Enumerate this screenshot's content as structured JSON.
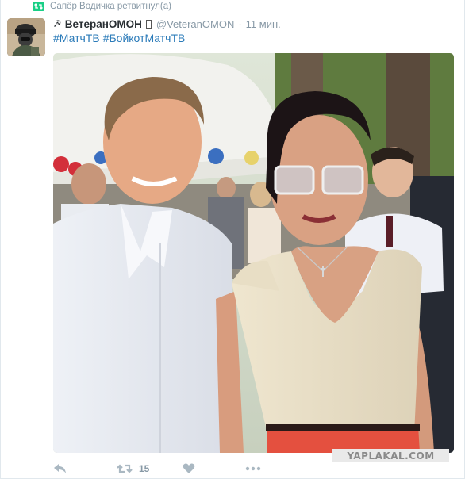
{
  "retweet_context": {
    "text": "Сапёр Водичка ретвитнул(а)",
    "icon": "retweet-icon"
  },
  "tweet": {
    "avatar": "avatar",
    "name_prefix_icon": "☭",
    "full_name": "ВетеранОМОН",
    "handle": "@VeteranOMON",
    "separator": "·",
    "time": "11 мин.",
    "hashtags": [
      "#МатчТВ",
      "#БойкотМатчТВ"
    ]
  },
  "media": {
    "type": "photo"
  },
  "watermark": "YAPLAKAL.COM",
  "actions": {
    "reply_icon": "reply-icon",
    "retweet_icon": "retweet-icon",
    "retweet_count": "15",
    "like_icon": "heart-icon",
    "more_icon": "more-icon"
  },
  "colors": {
    "link": "#2b7bb9",
    "muted": "#8899a6",
    "retweet_green": "#19cf86",
    "icon_gray": "#aab8c2"
  }
}
